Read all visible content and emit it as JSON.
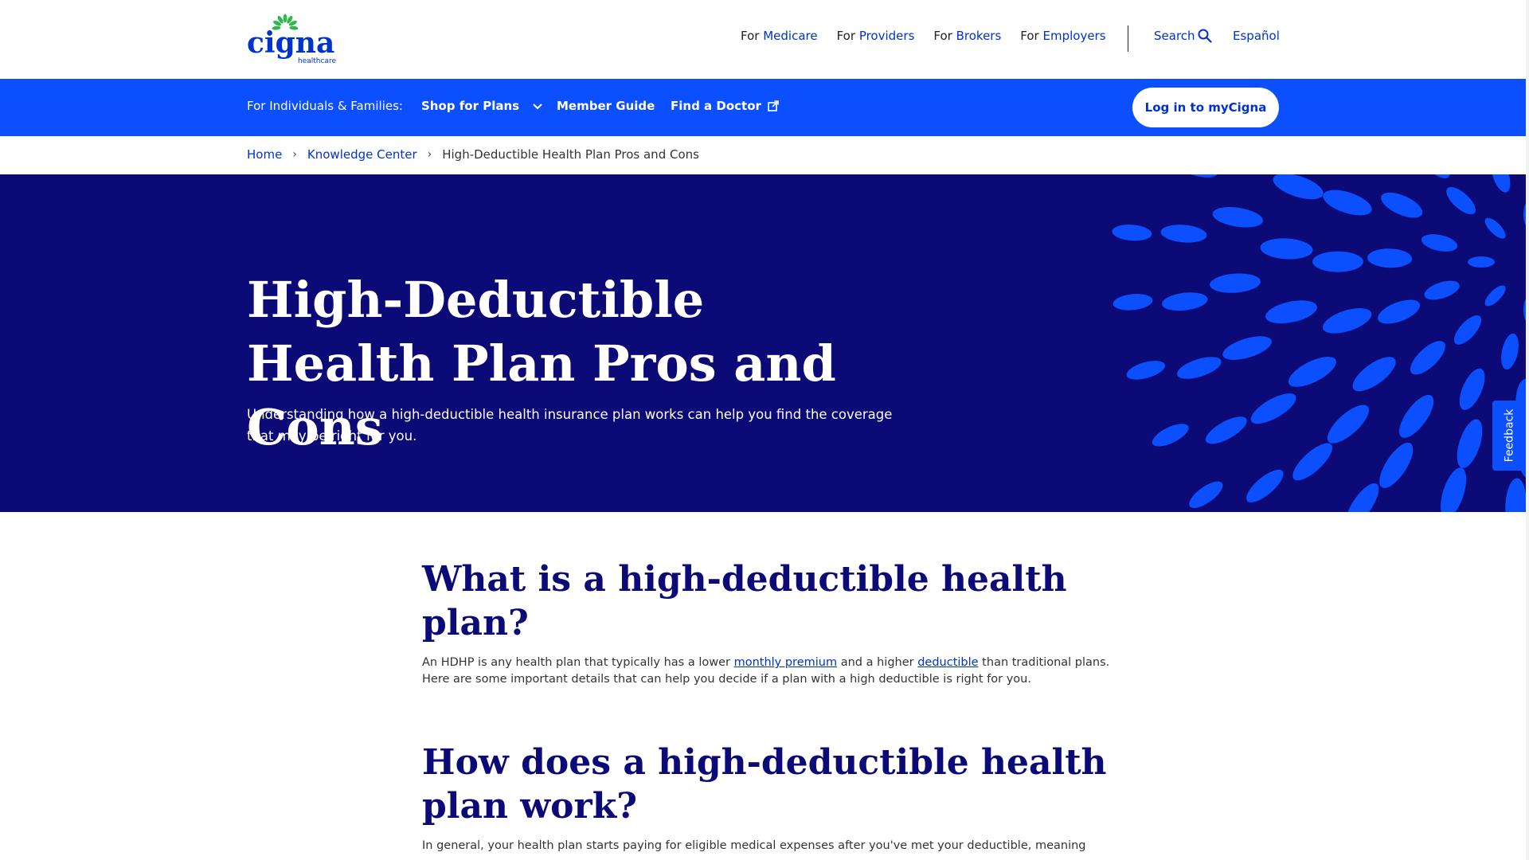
{
  "header": {
    "brand": "cigna",
    "brand_sub": "healthcare",
    "utility_nav": [
      {
        "prefix": "For",
        "label": "Medicare"
      },
      {
        "prefix": "For",
        "label": "Providers"
      },
      {
        "prefix": "For",
        "label": "Brokers"
      },
      {
        "prefix": "For",
        "label": "Employers"
      }
    ],
    "search_label": "Search",
    "language_label": "Español"
  },
  "main_nav": {
    "audience_label": "For Individuals & Families:",
    "shop_label": "Shop for Plans",
    "member_guide_label": "Member Guide",
    "find_doctor_label": "Find a Doctor",
    "login_label": "Log in to myCigna"
  },
  "breadcrumb": {
    "home": "Home",
    "section": "Knowledge Center",
    "current": "High-Deductible Health Plan Pros and Cons"
  },
  "hero": {
    "title": "High-Deductible Health Plan Pros and Cons",
    "subtitle": "Understanding how a high-deductible health insurance plan works can help you find the coverage that may be right for you."
  },
  "feedback_label": "Feedback",
  "article": {
    "h2_what": "What is a high-deductible health plan?",
    "p1_a": "An HDHP is any health plan that typically has a lower ",
    "p1_link1": "monthly premium",
    "p1_b": " and a higher ",
    "p1_link2": "deductible",
    "p1_c": " than traditional plans. Here are some important details that can help you decide if a plan with a high deductible is right for you.",
    "h2_how": "How does a high-deductible health plan work?",
    "p2": "In general, your health plan starts paying for eligible medical expenses after you've met your deductible, meaning"
  },
  "colors": {
    "nav_blue": "#0b4fff",
    "hero_navy": "#0c0a77",
    "link_blue": "#0033cc",
    "leaf_green": "#2fb84a"
  }
}
